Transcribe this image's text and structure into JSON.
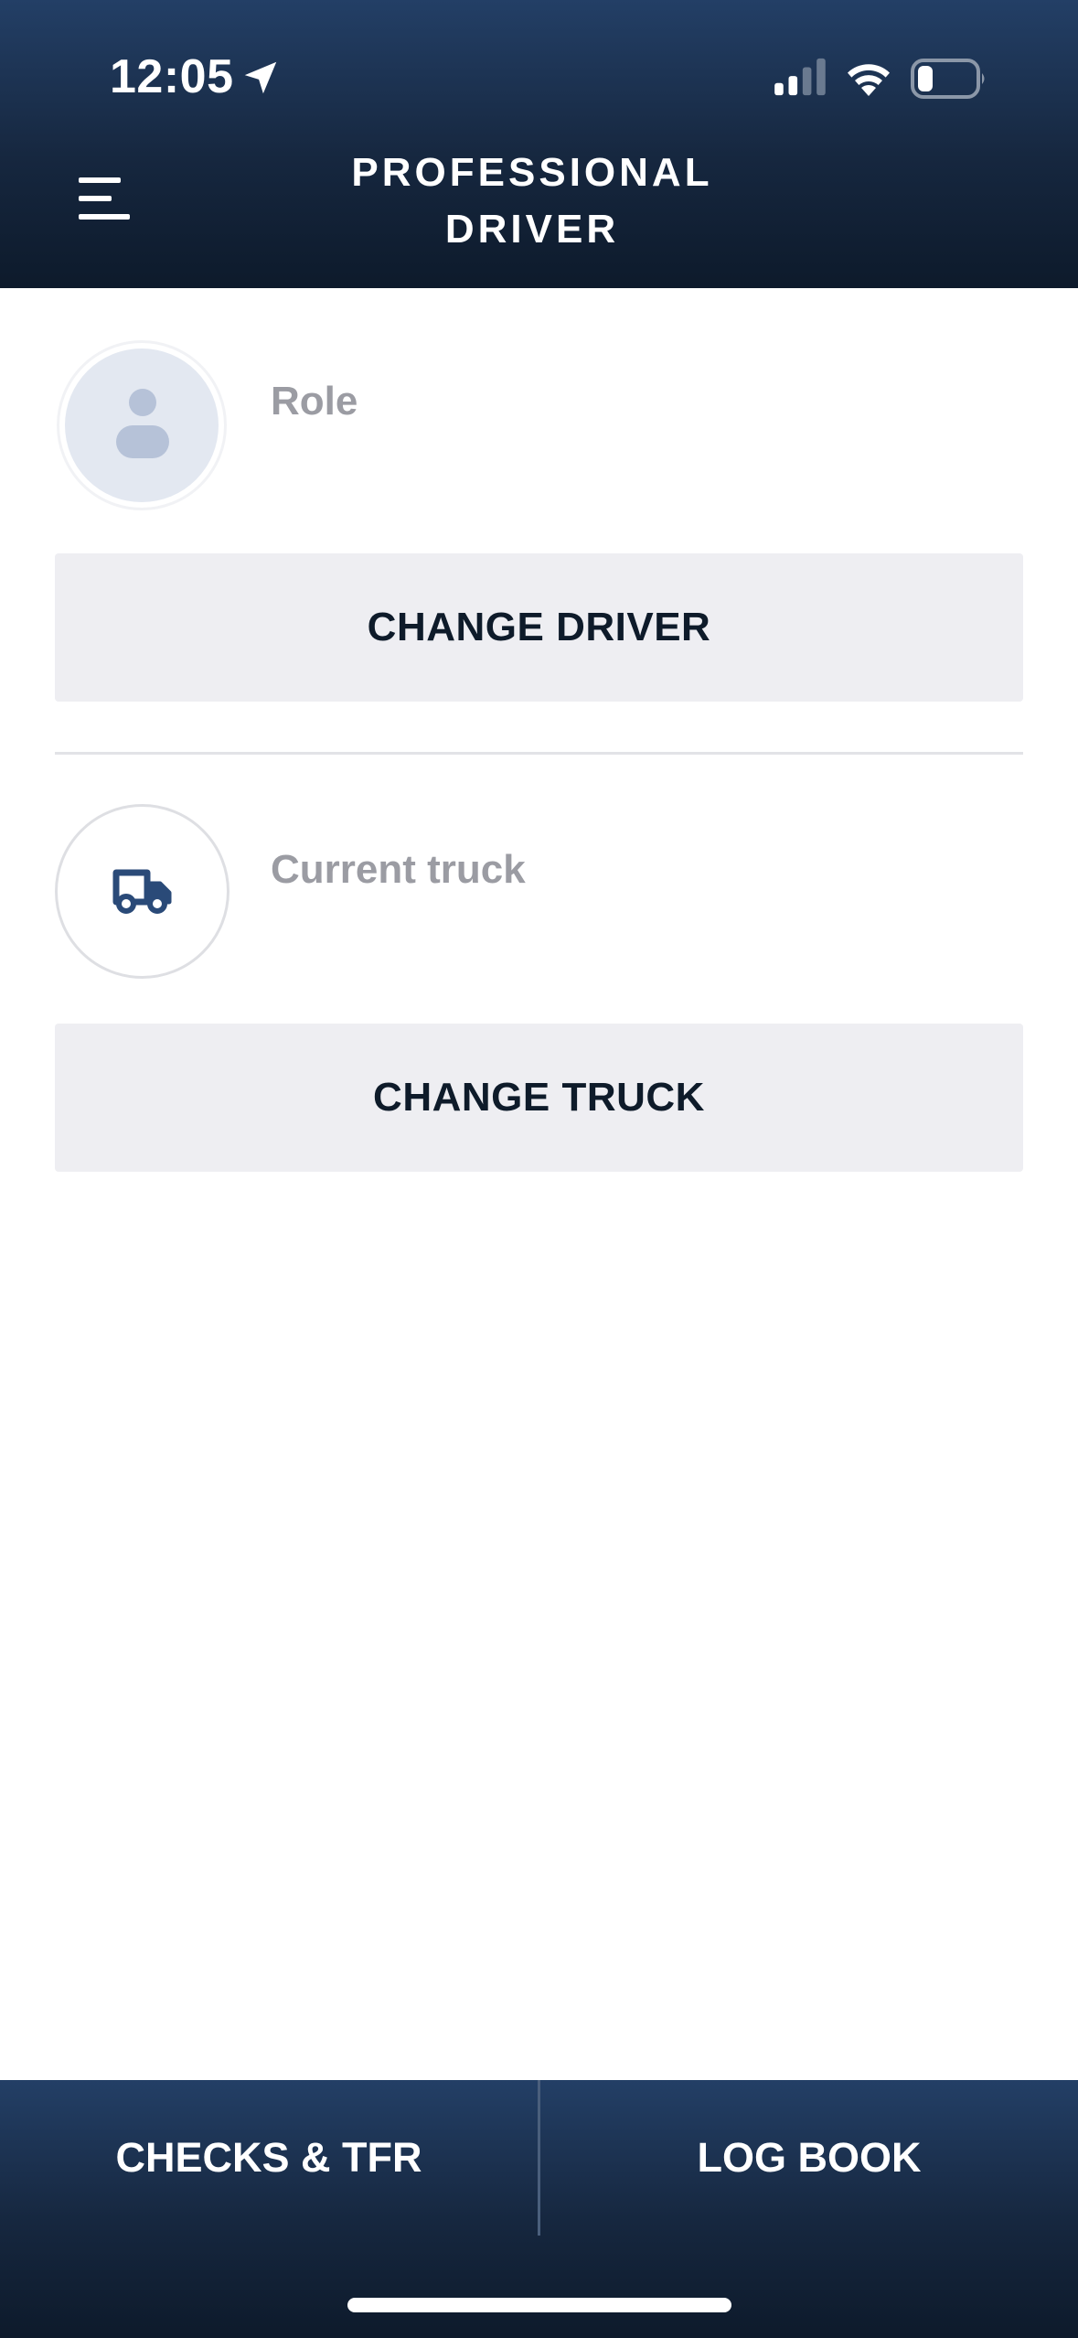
{
  "status_bar": {
    "time": "12:05",
    "location_icon": "location-arrow-icon",
    "signal_icon": "cellular-signal-icon",
    "wifi_icon": "wifi-icon",
    "battery_icon": "battery-icon"
  },
  "header": {
    "title": "PROFESSIONAL DRIVER",
    "menu_icon": "hamburger-menu-icon"
  },
  "driver_section": {
    "avatar_icon": "user-avatar-icon",
    "role_label": "Role",
    "change_button_label": "CHANGE DRIVER"
  },
  "truck_section": {
    "truck_icon": "truck-icon",
    "truck_label": "Current truck",
    "change_button_label": "CHANGE TRUCK"
  },
  "bottom_nav": {
    "tabs": [
      {
        "label": "CHECKS & TFR"
      },
      {
        "label": "LOG BOOK"
      }
    ]
  },
  "colors": {
    "header_bg": "#1a2e4a",
    "button_bg": "#eeeef2",
    "button_text": "#0e1b2a",
    "muted_text": "#9b9ca3",
    "truck_icon": "#2a4a78"
  }
}
